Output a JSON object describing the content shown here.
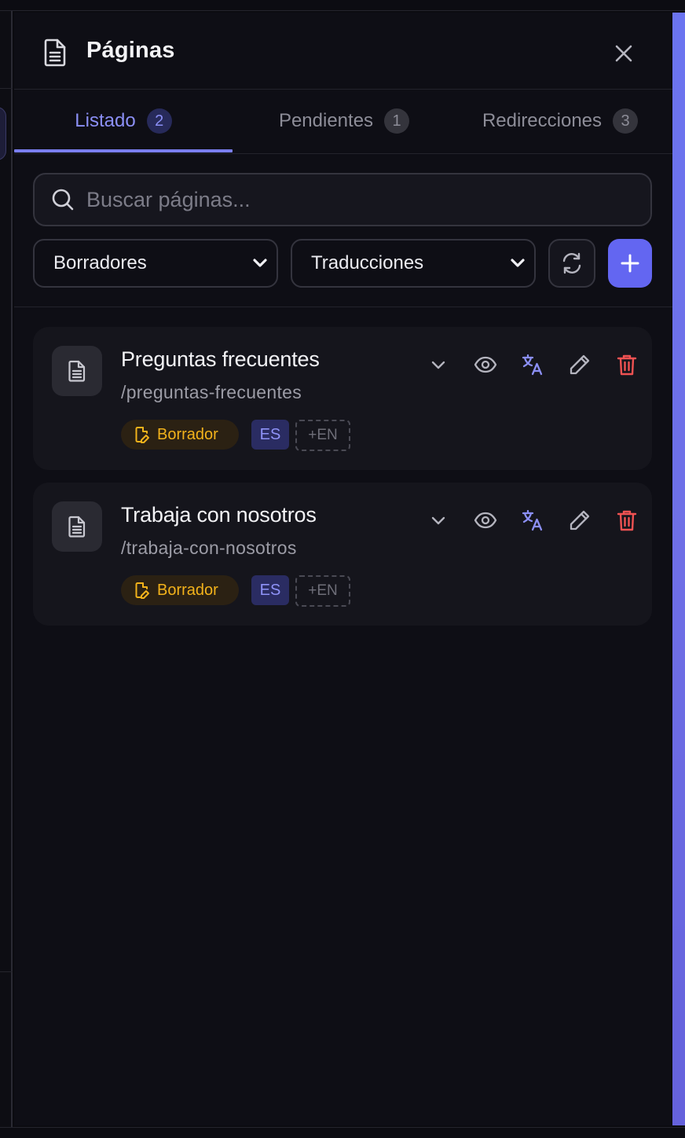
{
  "panel": {
    "title": "Páginas",
    "icons": {
      "title": "file-text-icon",
      "close": "close-icon"
    }
  },
  "tabs": [
    {
      "label": "Listado",
      "count": "2",
      "active": true
    },
    {
      "label": "Pendientes",
      "count": "1",
      "active": false
    },
    {
      "label": "Redirecciones",
      "count": "3",
      "active": false
    }
  ],
  "search": {
    "placeholder": "Buscar páginas...",
    "value": ""
  },
  "filters": {
    "status_select": "Borradores",
    "translations_select": "Traducciones"
  },
  "toolbar": {
    "refresh_icon": "refresh-icon",
    "add_icon": "plus-icon"
  },
  "pages": [
    {
      "title": "Preguntas frecuentes",
      "slug": "/preguntas-frecuentes",
      "status": "Borrador",
      "lang": "ES",
      "add_lang": "+EN"
    },
    {
      "title": "Trabaja con nosotros",
      "slug": "/trabaja-con-nosotros",
      "status": "Borrador",
      "lang": "ES",
      "add_lang": "+EN"
    }
  ],
  "colors": {
    "accent": "#6366f1",
    "active_tab": "#8b8ff5",
    "draft": "#f2b21b",
    "delete": "#f05252",
    "translate": "#8b8ff5"
  }
}
